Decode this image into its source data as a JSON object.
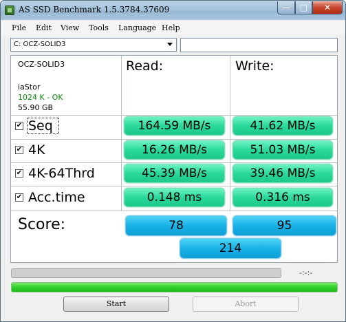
{
  "window": {
    "title": "AS SSD Benchmark 1.5.3784.37609",
    "buttons": {
      "minimize": "—",
      "maximize": "□",
      "close": "✕"
    }
  },
  "menu": [
    "File",
    "Edit",
    "View",
    "Tools",
    "Language",
    "Help"
  ],
  "drive_select": {
    "value": "C: OCZ-SOLID3"
  },
  "drive_info": {
    "name": "OCZ-SOLID3",
    "driver": "iaStor",
    "alignment": "1024 K - OK",
    "size": "55.90 GB"
  },
  "columns": {
    "read": "Read:",
    "write": "Write:"
  },
  "tests": [
    {
      "label": "Seq",
      "checked": true,
      "read": "164.59 MB/s",
      "write": "41.62 MB/s"
    },
    {
      "label": "4K",
      "checked": true,
      "read": "16.26 MB/s",
      "write": "51.03 MB/s"
    },
    {
      "label": "4K-64Thrd",
      "checked": true,
      "read": "45.39 MB/s",
      "write": "39.46 MB/s"
    },
    {
      "label": "Acc.time",
      "checked": true,
      "read": "0.148 ms",
      "write": "0.316 ms"
    }
  ],
  "score": {
    "label": "Score:",
    "read": "78",
    "write": "95",
    "total": "214"
  },
  "progress": {
    "fraction": 1.0,
    "elapsed": "-:-:-"
  },
  "buttons": {
    "start": "Start",
    "abort": "Abort"
  },
  "colors": {
    "result_green": "#2ad99a",
    "score_blue": "#18b2e6",
    "progress_green": "#2fcf2a",
    "ok_text": "#0a8a0a"
  }
}
